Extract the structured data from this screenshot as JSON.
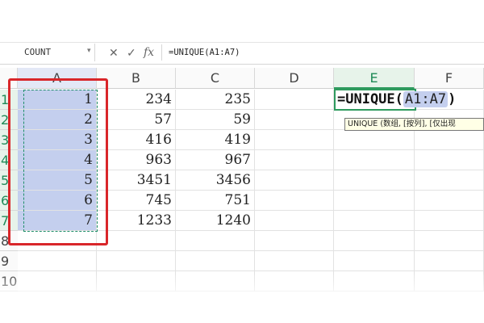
{
  "formula_bar": {
    "name_box": "COUNT",
    "cancel_icon": "✕",
    "enter_icon": "✓",
    "fx_label": "fx",
    "formula": "=UNIQUE(A1:A7)"
  },
  "columns": [
    "A",
    "B",
    "C",
    "D",
    "E",
    "F"
  ],
  "rows": [
    "1",
    "2",
    "3",
    "4",
    "5",
    "6",
    "7",
    "8",
    "9",
    "10"
  ],
  "cells": {
    "A": [
      "1",
      "2",
      "3",
      "4",
      "5",
      "6",
      "7"
    ],
    "B": [
      "234",
      "57",
      "416",
      "963",
      "3451",
      "745",
      "1233"
    ],
    "C": [
      "235",
      "59",
      "419",
      "967",
      "3456",
      "751",
      "1240"
    ]
  },
  "editing": {
    "func": "=UNIQUE(",
    "ref": "A1:A7",
    "close": ")"
  },
  "tooltip": "UNIQUE (数组, [按列], [仅出现",
  "colors": {
    "selection": "#c4cfee",
    "marquee": "#1f8f6a",
    "highlight_box": "#d9262a",
    "active_header": "#2e9a5e"
  }
}
